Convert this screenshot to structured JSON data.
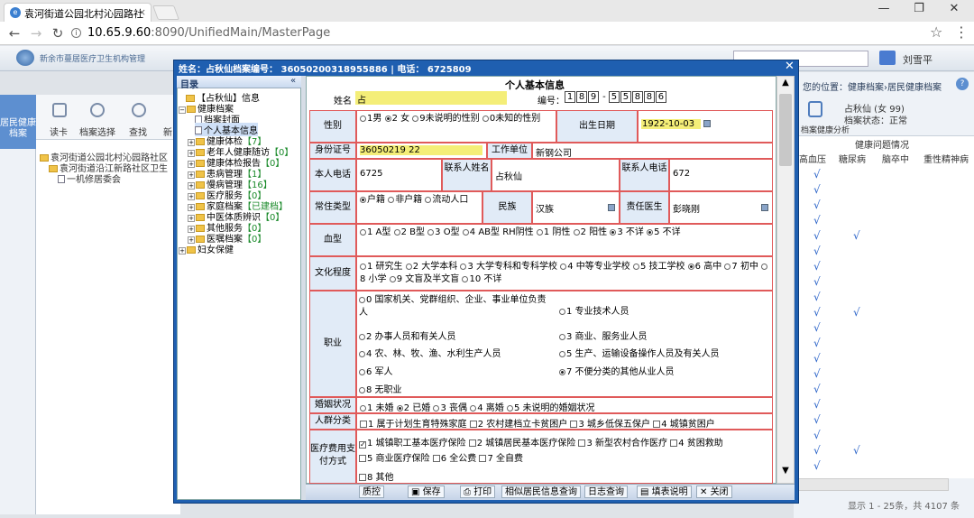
{
  "browser": {
    "tab_title": "袁河街道公园北村沁园路社",
    "url_host": "10.65.9.60",
    "url_rest": ":8090/UnifiedMain/MasterPage",
    "win_min": "—",
    "win_max": "❐",
    "win_close": "✕"
  },
  "app": {
    "org": "新余市蔓居医疗卫生机构管理",
    "user": "刘雪平",
    "side_tab": "居民健康档案",
    "tools": [
      "读卡",
      "档案选择",
      "查找",
      "新"
    ],
    "breadcrumb": "您的位置：健康档案›居民健康档案",
    "left_tree": [
      "袁河街道公园北村沁园路社区",
      "袁河街道沿江新路社区卫生",
      "一机修居委会"
    ],
    "right_info1": "占秋仙 (女 99)",
    "right_info2": "档案状态：正常",
    "right_btn": "档案健康分析",
    "grid_group": "健康问题情况",
    "grid_headers": [
      "高血压",
      "糖尿病",
      "脑卒中",
      "重性精神病"
    ],
    "grid_footer": "显示 1 - 25条，共 4107 条",
    "checkmark": "√"
  },
  "modal": {
    "title": "姓名：占秋仙档案编号： 36050200318955886 | 电话： 6725809",
    "close": "✕",
    "tree_header": "目录",
    "tree_collapse": "«",
    "tree": [
      {
        "label": "【占秋仙】信息",
        "extra": ""
      },
      {
        "label": "健康档案",
        "extra": ""
      },
      {
        "label": "档案封面",
        "extra": ""
      },
      {
        "label": "个人基本信息",
        "extra": ""
      },
      {
        "label": "健康体检",
        "extra": "【7】"
      },
      {
        "label": "老年人健康随访",
        "extra": "【0】"
      },
      {
        "label": "健康体检报告",
        "extra": "【0】"
      },
      {
        "label": "患病管理",
        "extra": "【1】"
      },
      {
        "label": "慢病管理",
        "extra": "【16】"
      },
      {
        "label": "医疗服务",
        "extra": "【0】"
      },
      {
        "label": "家庭档案",
        "extra": "【已建档】"
      },
      {
        "label": "中医体质辨识",
        "extra": "【0】"
      },
      {
        "label": "其他服务",
        "extra": "【0】"
      },
      {
        "label": "医嘱档案",
        "extra": "【0】"
      },
      {
        "label": "妇女保健",
        "extra": ""
      }
    ],
    "form_title": "个人基本信息",
    "name_label": "姓名",
    "name_value": "占",
    "serial_label": "编号：",
    "serial_a": [
      "1",
      "8",
      "9"
    ],
    "serial_b": [
      "5",
      "5",
      "8",
      "8",
      "6"
    ],
    "sex_label": "性别",
    "sex_options": [
      "1男",
      "2 女",
      "9未说明的性别",
      "0未知的性别"
    ],
    "birth_label": "出生日期",
    "birth_value": "1922-10-03",
    "id_label": "身份证号",
    "id_value": "36050219 22",
    "work_label": "工作单位",
    "work_value": "新钢公司",
    "phone_label": "本人电话",
    "phone_value": "6725",
    "contact_name_label": "联系人姓名",
    "contact_name_value": "占秋仙",
    "contact_phone_label": "联系人电话",
    "contact_phone_value": "672",
    "residence_label": "常住类型",
    "residence_options": [
      "户籍",
      "非户籍",
      "流动人口"
    ],
    "ethnic_label": "民族",
    "ethnic_value": "汉族",
    "doctor_label": "责任医生",
    "doctor_value": "彭晓刚",
    "blood_label": "血型",
    "blood_options": [
      "1 A型",
      "2 B型",
      "3 O型",
      "4 AB型",
      "5 不详"
    ],
    "rh_label": "RH阴性",
    "rh_options": [
      "1 阴性",
      "2 阳性",
      "3 不详"
    ],
    "edu_label": "文化程度",
    "edu_options": [
      "1 研究生",
      "2 大学本科",
      "3 大学专科和专科学校",
      "4 中等专业学校",
      "5 技工学校",
      "6 高中",
      "7 初中",
      "8 小学",
      "9 文盲及半文盲",
      "10 不详"
    ],
    "job_label": "职业",
    "job_options": [
      "0 国家机关、党群组织、企业、事业单位负责人",
      "1 专业技术人员",
      "2 办事人员和有关人员",
      "3 商业、服务业人员",
      "4 农、林、牧、渔、水利生产人员",
      "5 生产、运输设备操作人员及有关人员",
      "6 军人",
      "7 不便分类的其他从业人员",
      "8 无职业"
    ],
    "marriage_label": "婚姻状况",
    "marriage_options": [
      "1 未婚",
      "2 已婚",
      "3 丧偶",
      "4 离婚",
      "5 未说明的婚姻状况"
    ],
    "crowd_label": "人群分类",
    "crowd_options": [
      "1 属于计划生育特殊家庭",
      "2 农村建档立卡贫困户",
      "3 城乡低保五保户",
      "4 城镇贫困户"
    ],
    "pay_label": "医疗费用支付方式",
    "pay_options": [
      "1 城镇职工基本医疗保险",
      "2 城镇居民基本医疗保险",
      "3 新型农村合作医疗",
      "4 贫困救助",
      "5 商业医疗保险",
      "6 全公费",
      "7 全自费",
      "8 其他"
    ],
    "buttons": [
      "质控",
      "保存",
      "打印",
      "相似居民信息查询",
      "日志查询",
      "填表说明",
      "关闭"
    ],
    "scroll_up": "▲",
    "scroll_down": "▼"
  }
}
